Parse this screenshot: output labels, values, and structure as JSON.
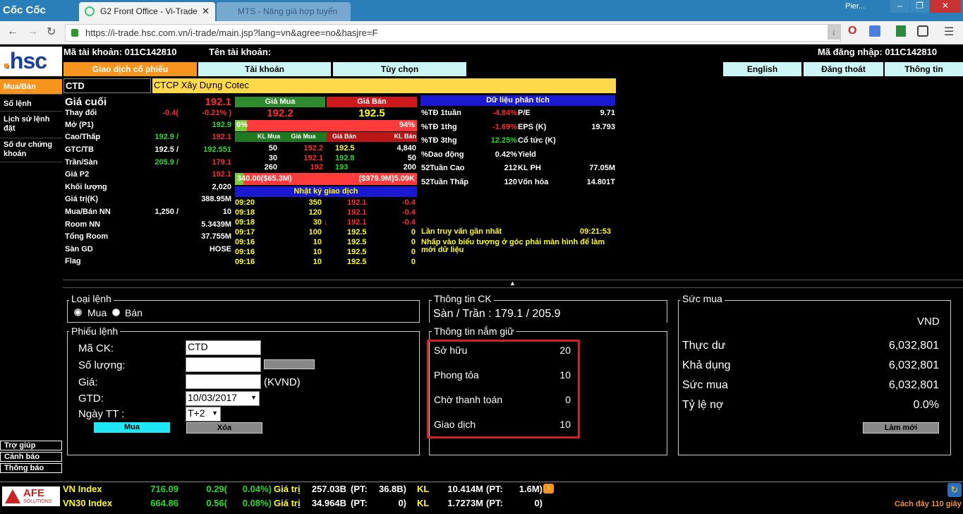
{
  "browser": {
    "name": "Cốc Cốc",
    "tab_active": "G2 Front Office - Vi-Trade",
    "tab_inactive": "MTS - Nâng giá hợp tuyển",
    "user": "Pier...",
    "url": "https://i-trade.hsc.com.vn/i-trade/main.jsp?lang=vn&agree=no&hasjre=F"
  },
  "header": {
    "account_no": "Mã tài khoản: 011C142810",
    "account_name": "Tên tài khoản:",
    "login": "Mã đăng nhập: 011C142810",
    "logo": ".hsc"
  },
  "nav": {
    "trade": "Giao dịch cổ phiếu",
    "account": "Tài khoản",
    "options": "Tùy chọn",
    "english": "English",
    "logout": "Đăng thoát",
    "info": "Thông tin"
  },
  "sidebar": {
    "buysell": "Mua/Bán",
    "orders": "Sổ lệnh",
    "history": "Lịch sử lệnh đặt",
    "balance": "Số dư chứng khoán",
    "help": "Trợ giúp",
    "alert": "Cảnh báo",
    "notice": "Thông báo"
  },
  "stock": {
    "code": "CTD",
    "name": "CTCP Xây Dựng Cotec"
  },
  "quote": {
    "rows": [
      {
        "label": "Giá cuối",
        "v1": "",
        "v2": "192.1"
      },
      {
        "label": "Thay đổi",
        "v1": "-0.4(",
        "v2": "-0.21% )"
      },
      {
        "label": "Mở (P1)",
        "v1": "",
        "v2": "192.9"
      },
      {
        "label": "Cao/Thấp",
        "v1": "192.9 /",
        "v2": "192.1"
      },
      {
        "label": "GTC/TB",
        "v1": "192.5 /",
        "v2": "192.551"
      },
      {
        "label": "Trần/Sàn",
        "v1": "205.9 /",
        "v2": "179.1"
      },
      {
        "label": "Giá P2",
        "v1": "",
        "v2": "192.1"
      },
      {
        "label": "Khối lượng",
        "v1": "",
        "v2": "2,020"
      },
      {
        "label": "Giá trị(K)",
        "v1": "",
        "v2": "388.95M"
      },
      {
        "label": "Mua/Bán NN",
        "v1": "1,250 /",
        "v2": "10"
      },
      {
        "label": "Room NN",
        "v1": "",
        "v2": "5.3439M"
      },
      {
        "label": "Tổng Room",
        "v1": "",
        "v2": "37.755M"
      },
      {
        "label": "Sàn GD",
        "v1": "",
        "v2": "HOSE"
      },
      {
        "label": "Flag",
        "v1": "",
        "v2": ""
      }
    ]
  },
  "book": {
    "buy_hdr": "Giá Mua",
    "sell_hdr": "Giá Bán",
    "buy_price": "192.2",
    "sell_price": "192.5",
    "buy_pct": "6%",
    "sell_pct": "94%",
    "col_hdrs": [
      "KL Mua",
      "Giá Mua",
      "Giá Bán",
      "KL Bán"
    ],
    "rows": [
      [
        "50",
        "192.2",
        "192.5",
        "4,840"
      ],
      [
        "30",
        "192.1",
        "192.8",
        "50"
      ],
      [
        "260",
        "192",
        "193",
        "200"
      ]
    ],
    "val_buy": "340.00($65.3M)",
    "val_sell": "($979.9M)5.09K"
  },
  "journal": {
    "title": "Nhật ký giao dịch",
    "rows": [
      [
        "09:20",
        "350",
        "192.1",
        "-0.4"
      ],
      [
        "09:18",
        "120",
        "192.1",
        "-0.4"
      ],
      [
        "09:18",
        "30",
        "192.1",
        "-0.4"
      ],
      [
        "09:17",
        "100",
        "192.5",
        "0"
      ],
      [
        "09:16",
        "10",
        "192.5",
        "0"
      ],
      [
        "09:16",
        "10",
        "192.5",
        "0"
      ],
      [
        "09:16",
        "10",
        "192.5",
        "0"
      ]
    ]
  },
  "analysis": {
    "title": "Dữ liệu phân tích",
    "rows": [
      [
        "%TĐ 1tuần",
        "-4.84%",
        "P/E",
        "9.71"
      ],
      [
        "%TĐ 1thg",
        "-1.69%",
        "EPS (K)",
        "19.793"
      ],
      [
        "%TĐ 3thg",
        "12.25%",
        "Cổ tức (K)",
        ""
      ],
      [
        "%Dao động",
        "0.42%",
        "Yield",
        ""
      ],
      [
        "52Tuần Cao",
        "212",
        "KL PH",
        "77.05M"
      ],
      [
        "52Tuần Thấp",
        "120",
        "Vốn hóa",
        "14.801T"
      ]
    ],
    "last_query_label": "Lần truy vấn gần nhất",
    "last_query_time": "09:21:53",
    "refresh_note": "Nhấp vào biểu tượng ở góc phải màn hình để làm mới dữ liệu"
  },
  "order": {
    "type_legend": "Loại lệnh",
    "buy": "Mua",
    "sell": "Bán",
    "form_legend": "Phiếu lệnh",
    "code_label": "Mã CK:",
    "code_value": "CTD",
    "qty_label": "Số lượng:",
    "price_label": "Giá:",
    "unit": "(KVND)",
    "gtd_label": "GTD:",
    "gtd_value": "10/03/2017",
    "tt_label": "Ngày TT :",
    "tt_value": "T+2",
    "submit": "Mua",
    "clear": "Xóa"
  },
  "stockinfo": {
    "legend": "Thông tin CK",
    "range": "Sàn / Trần : 179.1 / 205.9"
  },
  "holding": {
    "legend": "Thông tin nắm giữ",
    "rows": [
      [
        "Sở hữu",
        "20"
      ],
      [
        "Phong tỏa",
        "10"
      ],
      [
        "Chờ thanh toán",
        "0"
      ],
      [
        "Giao dịch",
        "10"
      ]
    ]
  },
  "power": {
    "legend": "Sức mua",
    "currency": "VND",
    "rows": [
      [
        "Thực dư",
        "6,032,801"
      ],
      [
        "Khả dụng",
        "6,032,801"
      ],
      [
        "Sức mua",
        "6,032,801"
      ],
      [
        "Tỷ lệ nợ",
        "0.0%"
      ]
    ],
    "refresh": "Làm mới"
  },
  "index": {
    "rows": [
      {
        "name": "VN Index",
        "value": "716.09",
        "chg": "0.29(",
        "pct": "0.04%)",
        "gt": "Giá trị",
        "gtv": "257.03B",
        "pt": "(PT:",
        "ptv": "36.8B)",
        "kl": "KL",
        "klv": "10.414M",
        "pt2": "(PT:",
        "pt2v": "1.6M)"
      },
      {
        "name": "VN30 Index",
        "value": "664.86",
        "chg": "0.56(",
        "pct": "0.08%)",
        "gt": "Giá trị",
        "gtv": "34.964B",
        "pt": "(PT:",
        "ptv": "0)",
        "kl": "KL",
        "klv": "1.7273M",
        "pt2": "(PT:",
        "pt2v": "0)"
      }
    ],
    "refresh_label": "Cách đây 110 giây",
    "logo": "AFE",
    "logo_sub": "SOLUTIONS"
  }
}
